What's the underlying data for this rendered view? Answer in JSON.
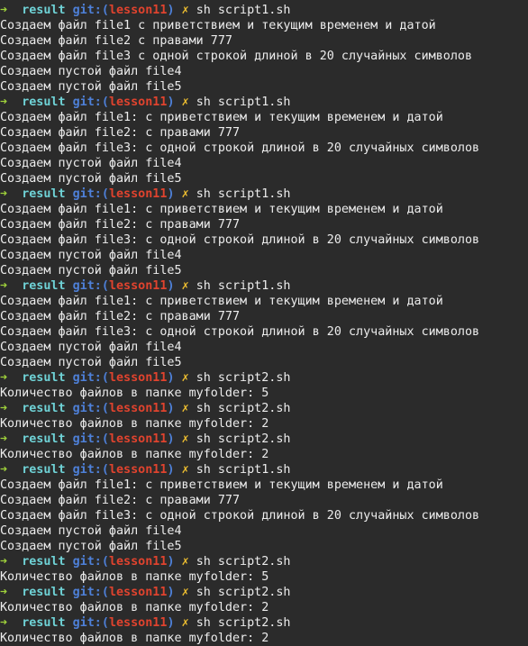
{
  "prompt": {
    "arrow": "➜",
    "dir": "result",
    "git_open": "git:(",
    "branch": "lesson11",
    "git_close": ")",
    "dirty": "✗"
  },
  "lines": [
    {
      "type": "prompt",
      "cmd": "sh script1.sh"
    },
    {
      "type": "output",
      "text": "Создаем файл file1 с приветствием и текущим временем и датой"
    },
    {
      "type": "output",
      "text": "Создаем файл file2 с правами 777"
    },
    {
      "type": "output",
      "text": "Создаем файл file3 с одной строкой длиной в 20 случайных символов"
    },
    {
      "type": "output",
      "text": "Создаем пустой файл file4"
    },
    {
      "type": "output",
      "text": "Создаем пустой файл file5"
    },
    {
      "type": "prompt",
      "cmd": "sh script1.sh"
    },
    {
      "type": "output",
      "text": "Создаем файл file1: с приветствием и текущим временем и датой"
    },
    {
      "type": "output",
      "text": "Создаем файл file2: с правами 777"
    },
    {
      "type": "output",
      "text": "Создаем файл file3: с одной строкой длиной в 20 случайных символов"
    },
    {
      "type": "output",
      "text": "Создаем пустой файл file4"
    },
    {
      "type": "output",
      "text": "Создаем пустой файл file5"
    },
    {
      "type": "prompt",
      "cmd": "sh script1.sh"
    },
    {
      "type": "output",
      "text": "Создаем файл file1: с приветствием и текущим временем и датой"
    },
    {
      "type": "output",
      "text": "Создаем файл file2: с правами 777"
    },
    {
      "type": "output",
      "text": "Создаем файл file3: с одной строкой длиной в 20 случайных символов"
    },
    {
      "type": "output",
      "text": "Создаем пустой файл file4"
    },
    {
      "type": "output",
      "text": "Создаем пустой файл file5"
    },
    {
      "type": "prompt",
      "cmd": "sh script1.sh"
    },
    {
      "type": "output",
      "text": "Создаем файл file1: с приветствием и текущим временем и датой"
    },
    {
      "type": "output",
      "text": "Создаем файл file2: с правами 777"
    },
    {
      "type": "output",
      "text": "Создаем файл file3: с одной строкой длиной в 20 случайных символов"
    },
    {
      "type": "output",
      "text": "Создаем пустой файл file4"
    },
    {
      "type": "output",
      "text": "Создаем пустой файл file5"
    },
    {
      "type": "prompt",
      "cmd": "sh script2.sh"
    },
    {
      "type": "output",
      "text": "Количество файлов в папке myfolder: 5"
    },
    {
      "type": "prompt",
      "cmd": "sh script2.sh"
    },
    {
      "type": "output",
      "text": "Количество файлов в папке myfolder: 2"
    },
    {
      "type": "prompt",
      "cmd": "sh script2.sh"
    },
    {
      "type": "output",
      "text": "Количество файлов в папке myfolder: 2"
    },
    {
      "type": "prompt",
      "cmd": "sh script1.sh"
    },
    {
      "type": "output",
      "text": "Создаем файл file1: с приветствием и текущим временем и датой"
    },
    {
      "type": "output",
      "text": "Создаем файл file2: с правами 777"
    },
    {
      "type": "output",
      "text": "Создаем файл file3: с одной строкой длиной в 20 случайных символов"
    },
    {
      "type": "output",
      "text": "Создаем пустой файл file4"
    },
    {
      "type": "output",
      "text": "Создаем пустой файл file5"
    },
    {
      "type": "prompt",
      "cmd": "sh script2.sh"
    },
    {
      "type": "output",
      "text": "Количество файлов в папке myfolder: 5"
    },
    {
      "type": "prompt",
      "cmd": "sh script2.sh"
    },
    {
      "type": "output",
      "text": "Количество файлов в папке myfolder: 2"
    },
    {
      "type": "prompt",
      "cmd": "sh script2.sh"
    },
    {
      "type": "output",
      "text": "Количество файлов в папке myfolder: 2"
    }
  ]
}
